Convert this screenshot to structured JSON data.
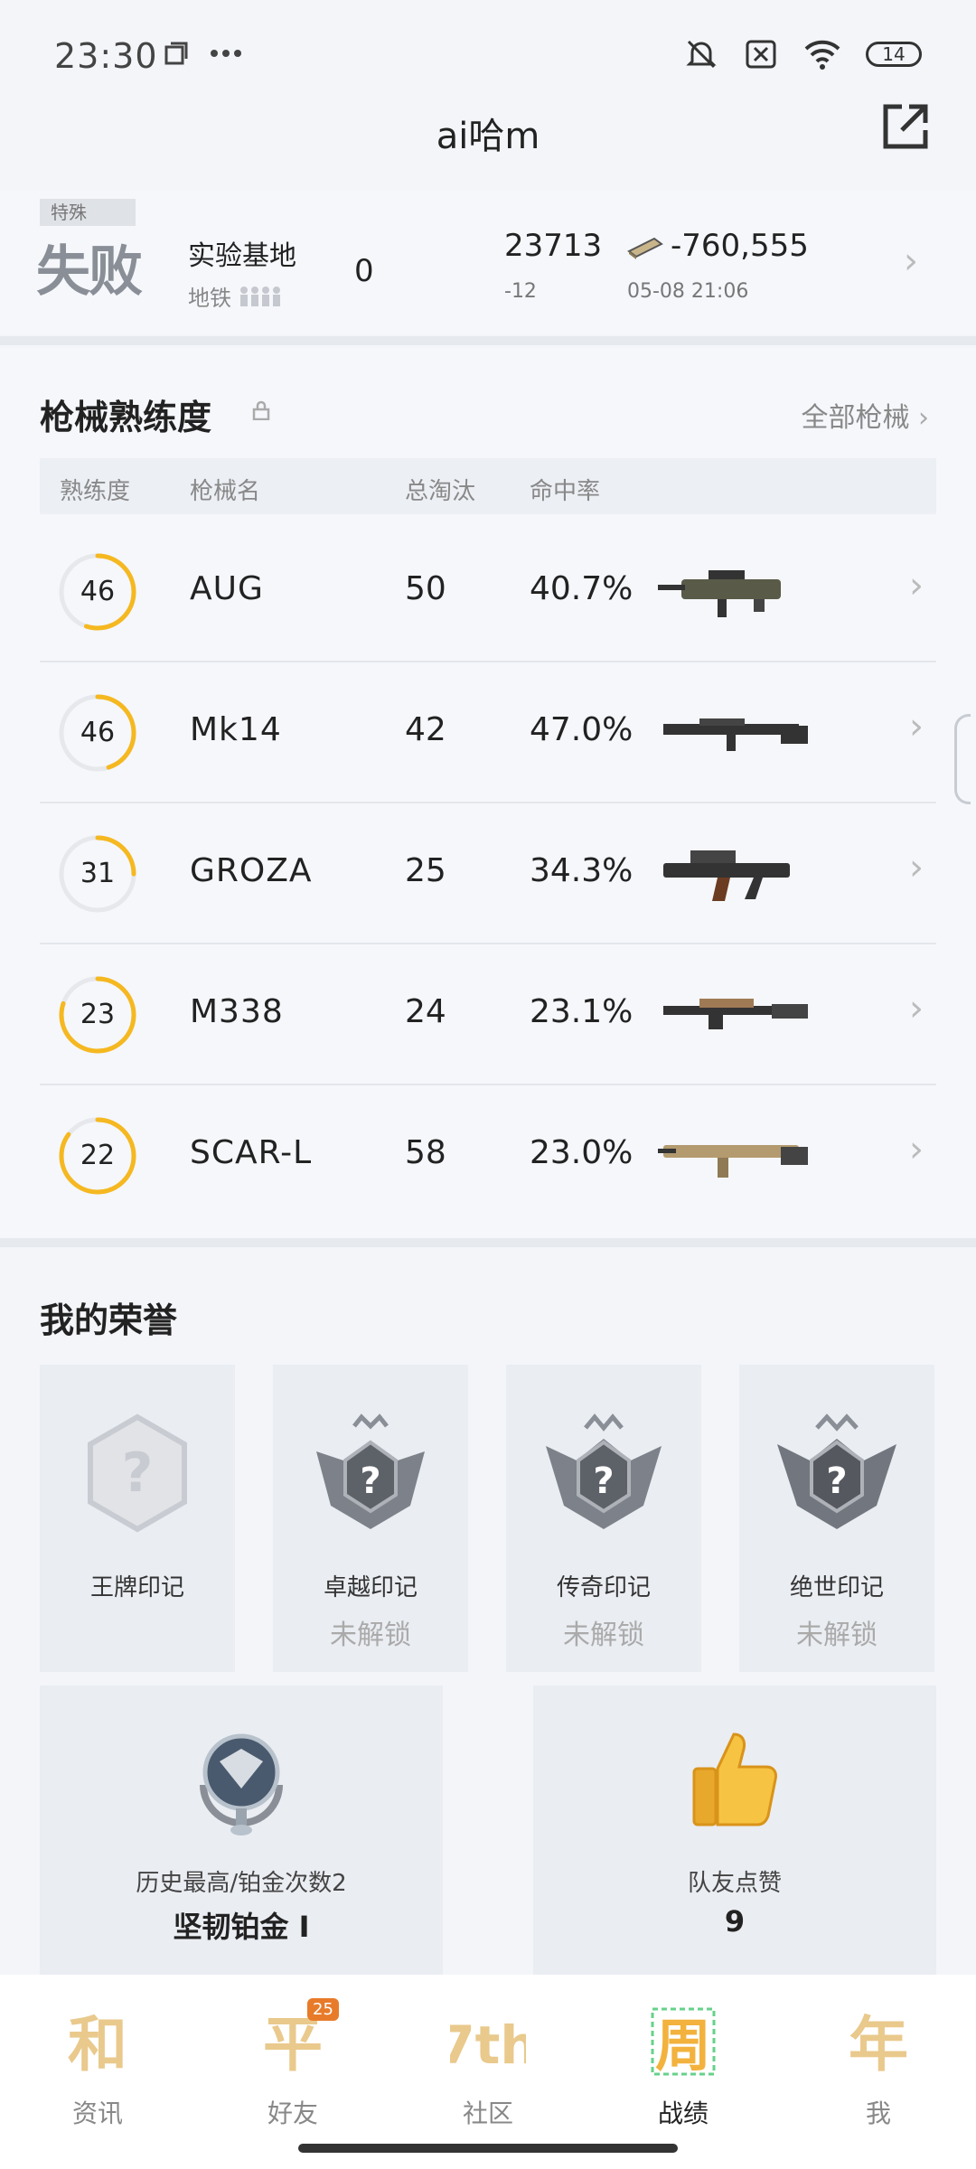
{
  "status_bar": {
    "time": "23:30",
    "battery": "14",
    "icons": [
      "copy-icon",
      "more-dots-icon",
      "mute-icon",
      "sim-off-icon",
      "wifi-icon",
      "battery-icon"
    ]
  },
  "header": {
    "title": "ai哈m"
  },
  "match": {
    "tag": "特殊",
    "result": "失败",
    "map": "实验基地",
    "mode": "地铁",
    "kills": "0",
    "rating": "23713",
    "rating_delta": "-12",
    "money": "-760,555",
    "time": "05-08 21:06"
  },
  "weapons": {
    "title": "枪械熟练度",
    "all_link": "全部枪械",
    "columns": [
      "熟练度",
      "枪械名",
      "总淘汰",
      "命中率"
    ],
    "rows": [
      {
        "level": "46",
        "name": "AUG",
        "kills": "50",
        "accuracy": "40.7%",
        "progress": 0.55
      },
      {
        "level": "46",
        "name": "Mk14",
        "kills": "42",
        "accuracy": "47.0%",
        "progress": 0.45
      },
      {
        "level": "31",
        "name": "GROZA",
        "kills": "25",
        "accuracy": "34.3%",
        "progress": 0.25
      },
      {
        "level": "23",
        "name": "M338",
        "kills": "24",
        "accuracy": "23.1%",
        "progress": 0.8
      },
      {
        "level": "22",
        "name": "SCAR-L",
        "kills": "58",
        "accuracy": "23.0%",
        "progress": 0.85
      }
    ]
  },
  "honors": {
    "title": "我的荣誉",
    "cards": [
      {
        "name": "王牌印记",
        "state": ""
      },
      {
        "name": "卓越印记",
        "state": "未解锁"
      },
      {
        "name": "传奇印记",
        "state": "未解锁"
      },
      {
        "name": "绝世印记",
        "state": "未解锁"
      }
    ],
    "rank": {
      "label": "历史最高/铂金次数2",
      "value": "坚韧铂金 Ⅰ"
    },
    "likes": {
      "label": "队友点赞",
      "value": "9"
    }
  },
  "nav": {
    "items": [
      {
        "label": "资讯",
        "glyph": "和"
      },
      {
        "label": "好友",
        "glyph": "平",
        "badge": "25"
      },
      {
        "label": "社区",
        "glyph": "7th"
      },
      {
        "label": "战绩",
        "glyph": "周"
      },
      {
        "label": "我",
        "glyph": "年"
      }
    ]
  },
  "colors": {
    "accent": "#f5b820",
    "ring_track": "#e6e8ec",
    "background": "#f3f5f9"
  }
}
